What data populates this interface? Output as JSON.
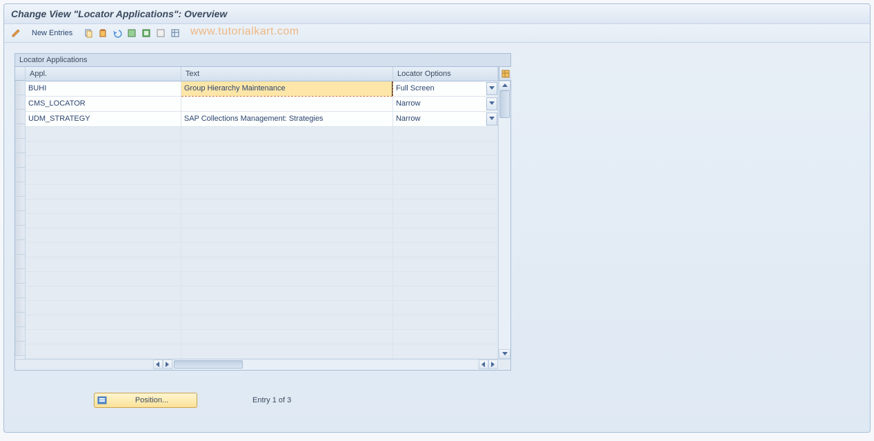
{
  "title": "Change View \"Locator Applications\": Overview",
  "toolbar": {
    "new_entries_label": "New Entries"
  },
  "watermark": "www.tutorialkart.com",
  "table": {
    "title": "Locator Applications",
    "columns": {
      "appl": "Appl.",
      "text": "Text",
      "locator_options": "Locator Options"
    },
    "rows": [
      {
        "appl": "BUHI",
        "text": "Group Hierarchy Maintenance",
        "locator": "Full Screen",
        "highlighted": true
      },
      {
        "appl": "CMS_LOCATOR",
        "text": "",
        "locator": "Narrow",
        "highlighted": false
      },
      {
        "appl": "UDM_STRATEGY",
        "text": "SAP Collections Management: Strategies",
        "locator": "Narrow",
        "highlighted": false
      }
    ]
  },
  "footer": {
    "position_label": "Position...",
    "entry_label": "Entry 1 of 3"
  }
}
